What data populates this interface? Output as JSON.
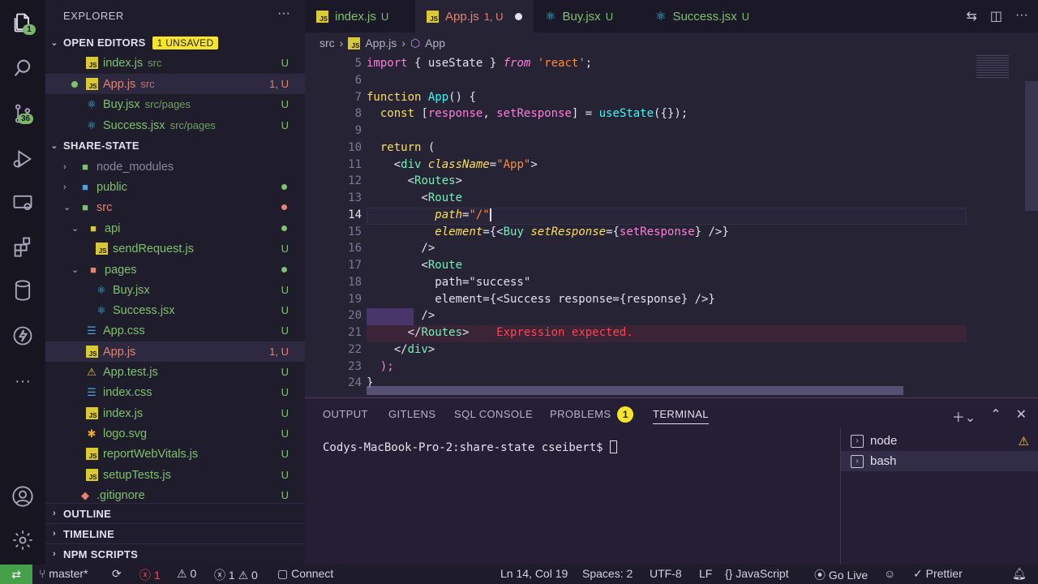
{
  "activity": {
    "scm_badge": "36",
    "explorer_badge": "1"
  },
  "sidebar": {
    "title": "EXPLORER",
    "more": "···",
    "open_editors_label": "OPEN EDITORS",
    "unsaved_badge": "1 UNSAVED",
    "open_editors": [
      {
        "name": "index.js",
        "desc": "src",
        "status": "U"
      },
      {
        "name": "App.js",
        "desc": "src",
        "status": "1, U"
      },
      {
        "name": "Buy.jsx",
        "desc": "src/pages",
        "status": "U"
      },
      {
        "name": "Success.jsx",
        "desc": "src/pages",
        "status": "U"
      }
    ],
    "project_label": "SHARE-STATE",
    "tree": [
      {
        "name": "node_modules",
        "status": ""
      },
      {
        "name": "public",
        "status": ""
      },
      {
        "name": "src",
        "status": ""
      },
      {
        "name": "api",
        "status": ""
      },
      {
        "name": "sendRequest.js",
        "status": "U"
      },
      {
        "name": "pages",
        "status": ""
      },
      {
        "name": "Buy.jsx",
        "status": "U"
      },
      {
        "name": "Success.jsx",
        "status": "U"
      },
      {
        "name": "App.css",
        "status": "U"
      },
      {
        "name": "App.js",
        "status": "1, U"
      },
      {
        "name": "App.test.js",
        "status": "U"
      },
      {
        "name": "index.css",
        "status": "U"
      },
      {
        "name": "index.js",
        "status": "U"
      },
      {
        "name": "logo.svg",
        "status": "U"
      },
      {
        "name": "reportWebVitals.js",
        "status": "U"
      },
      {
        "name": "setupTests.js",
        "status": "U"
      },
      {
        "name": ".gitignore",
        "status": "U"
      }
    ],
    "outline_label": "OUTLINE",
    "timeline_label": "TIMELINE",
    "npm_label": "NPM SCRIPTS"
  },
  "tabs": [
    {
      "label": "index.js",
      "status": "U"
    },
    {
      "label": "App.js",
      "status": "1, U"
    },
    {
      "label": "Buy.jsx",
      "status": "U"
    },
    {
      "label": "Success.jsx",
      "status": "U"
    }
  ],
  "breadcrumb": {
    "folder": "src",
    "sep1": "›",
    "file": "App.js",
    "sep2": "›",
    "symbol": "App"
  },
  "editor": {
    "line_numbers": [
      "5",
      "6",
      "7",
      "8",
      "9",
      "10",
      "11",
      "12",
      "13",
      "14",
      "15",
      "16",
      "17",
      "18",
      "19",
      "20",
      "21",
      "22",
      "23",
      "24"
    ],
    "error_message": "Expression expected."
  },
  "panel": {
    "tabs": [
      "OUTPUT",
      "GITLENS",
      "SQL CONSOLE",
      "PROBLEMS",
      "TERMINAL"
    ],
    "problems_count": "1",
    "prompt": "Codys-MacBook-Pro-2:share-state cseibert$ ",
    "terminals": [
      "node",
      "bash"
    ]
  },
  "status": {
    "branch": "master*",
    "errors": "1",
    "warnings": "0",
    "info": "1",
    "info2": "0",
    "connect": "Connect",
    "position": "Ln 14, Col 19",
    "spaces": "Spaces: 2",
    "encoding": "UTF-8",
    "eol": "LF",
    "language": "JavaScript",
    "golive": "Go Live",
    "prettier": "Prettier"
  }
}
